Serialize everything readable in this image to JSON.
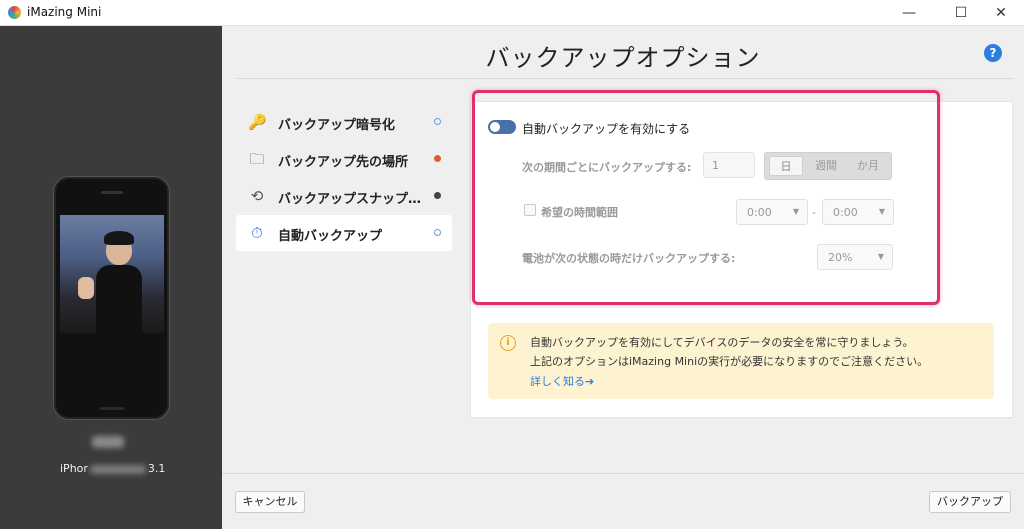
{
  "window": {
    "title": "iMazing Mini",
    "minimize": "—",
    "maximize": "☐",
    "close": "✕"
  },
  "device": {
    "model_prefix": "iPhor",
    "model_suffix": "3.1"
  },
  "main": {
    "title": "バックアップオプション",
    "help": "?"
  },
  "menu": {
    "items": [
      {
        "label": "バックアップ暗号化",
        "icon": "key-icon",
        "glyph": "🔑"
      },
      {
        "label": "バックアップ先の場所",
        "icon": "folder-icon",
        "glyph": "🗀"
      },
      {
        "label": "バックアップスナップショット",
        "icon": "snapshot-icon",
        "glyph": "⟲"
      },
      {
        "label": "自動バックアップ",
        "icon": "auto-backup-clock-icon",
        "glyph": "⏱"
      }
    ]
  },
  "options": {
    "auto_backup_toggle": "自動バックアップを有効にする",
    "interval_label": "次の期間ごとにバックアップする:",
    "interval_value": "1",
    "interval_units": [
      "日",
      "週間",
      "か月"
    ],
    "time_range_label": "希望の時間範囲",
    "time_from": "0:00",
    "time_to": "0:00",
    "dash": "-",
    "battery_label": "電池が次の状態の時だけバックアップする:",
    "battery_value": "20%"
  },
  "info": {
    "icon": "i",
    "line1": "自動バックアップを有効にしてデバイスのデータの安全を常に守りましょう。",
    "line2": "上記のオプションはiMazing Miniの実行が必要になりますのでご注意ください。",
    "link": "詳しく知る➔"
  },
  "footer": {
    "cancel": "キャンセル",
    "backup": "バックアップ"
  }
}
